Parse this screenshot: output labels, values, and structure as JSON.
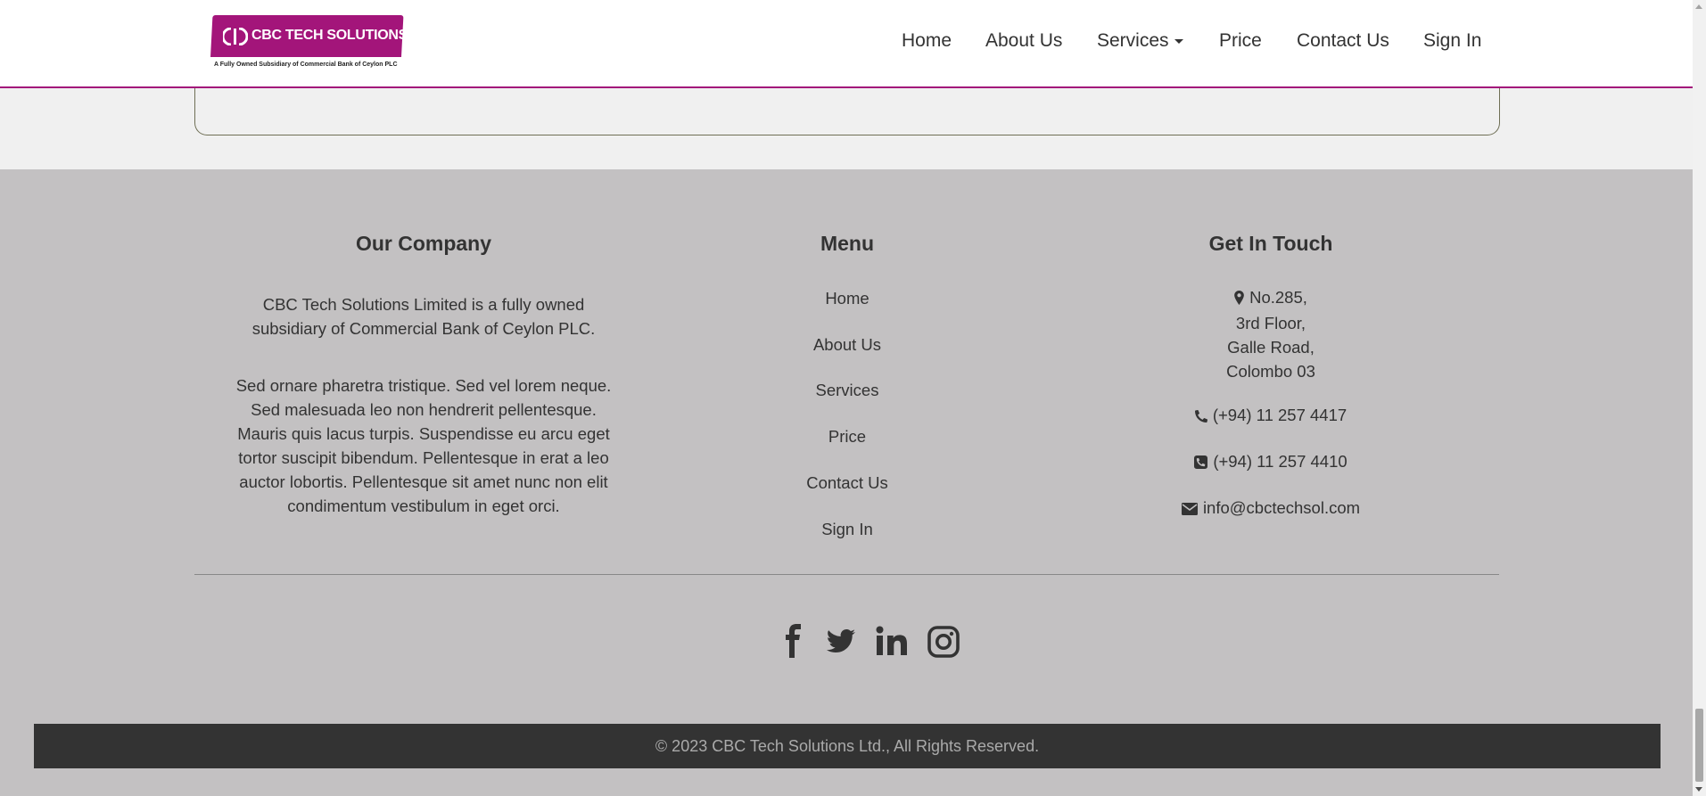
{
  "header": {
    "logo": {
      "brand": "CBC TECH SOLUTIONS",
      "tagline": "A Fully Owned Subsidiary of Commercial Bank of Ceylon PLC",
      "color": "#a3157a"
    },
    "nav": [
      {
        "label": "Home"
      },
      {
        "label": "About Us"
      },
      {
        "label": "Services",
        "has_dropdown": true
      },
      {
        "label": "Price"
      },
      {
        "label": "Contact Us"
      },
      {
        "label": "Sign In"
      }
    ]
  },
  "footer": {
    "company": {
      "title": "Our Company",
      "intro": "CBC Tech Solutions Limited is a fully owned subsidiary of Commercial Bank of Ceylon PLC.",
      "body": "Sed ornare pharetra tristique. Sed vel lorem neque. Sed malesuada leo non hendrerit pellentesque. Mauris quis lacus turpis. Suspendisse eu arcu eget tortor suscipit bibendum. Pellentesque in erat a leo auctor lobortis. Pellentesque sit amet nunc non elit condimentum vestibulum in eget orci."
    },
    "menu": {
      "title": "Menu",
      "links": [
        "Home",
        "About Us",
        "Services",
        "Price",
        "Contact Us",
        "Sign In"
      ]
    },
    "contact": {
      "title": "Get In Touch",
      "address": [
        "No.285,",
        "3rd Floor,",
        "Galle Road,",
        "Colombo 03"
      ],
      "phone": "(+94) 11 257 4417",
      "fax": "(+94) 11 257 4410",
      "email": "info@cbctechsol.com",
      "icons": [
        "map-marker-icon",
        "phone-icon",
        "fax-icon",
        "envelope-icon"
      ]
    },
    "social": [
      "facebook-icon",
      "twitter-icon",
      "linkedin-icon",
      "instagram-icon"
    ],
    "copyright": "© 2023 CBC Tech Solutions Ltd., All Rights Reserved."
  }
}
